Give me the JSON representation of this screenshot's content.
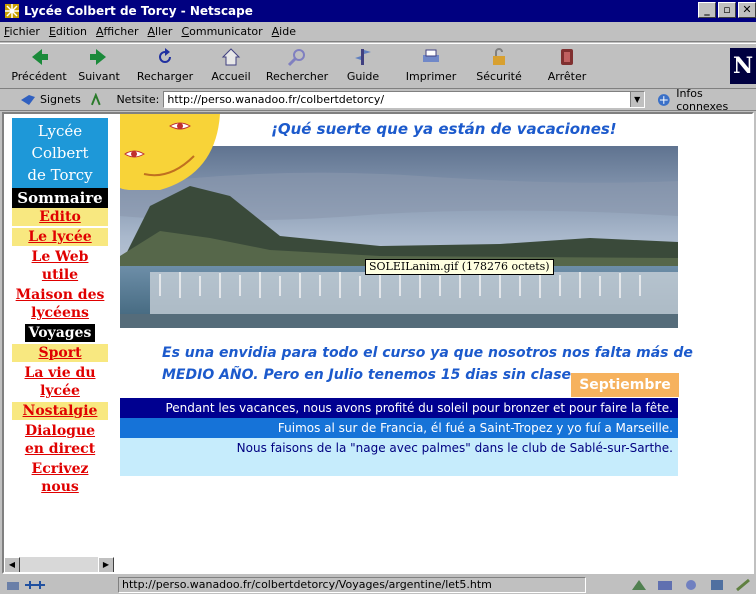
{
  "window": {
    "title": "Lycée Colbert de Torcy - Netscape"
  },
  "menu": [
    "Fichier",
    "Edition",
    "Afficher",
    "Aller",
    "Communicator",
    "Aide"
  ],
  "toolbar": [
    {
      "label": "Précédent",
      "icon": "back-arrow-icon"
    },
    {
      "label": "Suivant",
      "icon": "forward-arrow-icon"
    },
    {
      "label": "Recharger",
      "icon": "reload-icon"
    },
    {
      "label": "Accueil",
      "icon": "home-icon"
    },
    {
      "label": "Rechercher",
      "icon": "search-icon"
    },
    {
      "label": "Guide",
      "icon": "guide-icon"
    },
    {
      "label": "Imprimer",
      "icon": "print-icon"
    },
    {
      "label": "Sécurité",
      "icon": "lock-icon"
    },
    {
      "label": "Arrêter",
      "icon": "stop-icon"
    }
  ],
  "location": {
    "bookmarks_label": "Signets",
    "netsite_label": "Netsite:",
    "url": "http://perso.wanadoo.fr/colbertdetorcy/",
    "related_label": "Infos connexes"
  },
  "sidebar": {
    "school": [
      "Lycée",
      "Colbert",
      "de Torcy"
    ],
    "summary_label": "Sommaire",
    "items": [
      {
        "label": "Edito",
        "active": false
      },
      {
        "label": "Le lycée",
        "active": false
      },
      {
        "label": "Le Web utile",
        "active": false
      },
      {
        "label": "Maison des lycéens",
        "active": false
      },
      {
        "label": "Voyages",
        "active": true
      },
      {
        "label": "Sport",
        "active": false
      },
      {
        "label": "La vie du lycée",
        "active": false
      },
      {
        "label": "Nostalgie",
        "active": false
      },
      {
        "label": "Dialogue en direct",
        "active": false
      },
      {
        "label": "Ecrivez nous",
        "active": false
      }
    ]
  },
  "main": {
    "headline": "¡Qué suerte que ya están de vacaciones!",
    "tooltip": "SOLEILanim.gif (178276 octets)",
    "paragraph": "Es una envidia para todo el curso ya que nosotros nos falta más de MEDIO AÑO. Pero en Julio tenemos 15 dias sin clase.",
    "badge": "Septiembre",
    "lines": [
      "Pendant les vacances, nous avons profité du soleil pour bronzer et pour faire la fête.",
      "Fuimos al sur de Francia, él fué a Saint-Tropez y yo fuí a Marseille.",
      "Nous faisons de la \"nage avec palmes\" dans le club de Sablé-sur-Sarthe."
    ]
  },
  "status": {
    "text": "http://perso.wanadoo.fr/colbertdetorcy/Voyages/argentine/let5.htm"
  },
  "colors": {
    "title_bar": "#000080",
    "school_box": "#1e98d8",
    "nav_bg": "#f8e880",
    "nav_text": "#e00000",
    "headline": "#1c5acc",
    "badge": "#f6b25e",
    "bar1": "#000090",
    "bar2": "#1673d8",
    "bar3": "#c6ecfc"
  }
}
